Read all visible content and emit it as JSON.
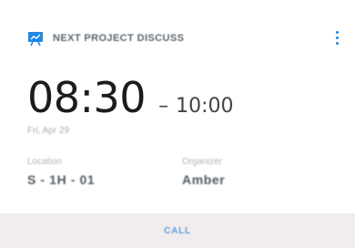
{
  "event": {
    "title": "NEXT PROJECT DISCUSS",
    "start_time": "08:30",
    "separator": "–",
    "end_time": "10:00",
    "date": "Fri, Apr 29"
  },
  "details": {
    "location_label": "Location",
    "location_value": "S - 1H - 01",
    "organizer_label": "Organizer",
    "organizer_value": "Amber"
  },
  "actions": {
    "call_label": "CALL"
  },
  "icons": {
    "event_icon": "presentation-icon",
    "menu_icon": "more-vert-icon"
  },
  "colors": {
    "accent": "#1e88e5",
    "footer_bg": "#f1edee",
    "call_text": "#5c9fe0"
  }
}
